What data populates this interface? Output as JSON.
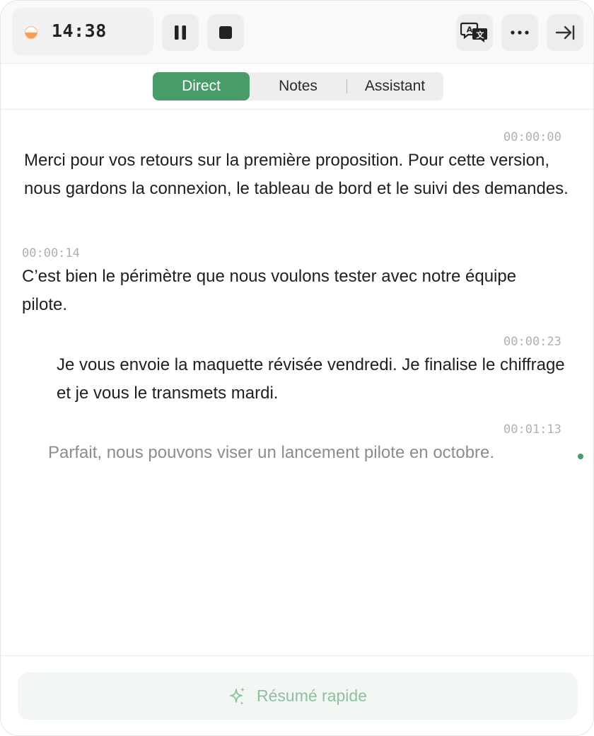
{
  "header": {
    "timer": "14:38",
    "buttons": {
      "pause": "pause-icon",
      "stop": "stop-icon",
      "translate": "translate-icon",
      "more": "more-icon",
      "collapse": "collapse-right-icon"
    }
  },
  "tabs": [
    {
      "label": "Direct",
      "active": true
    },
    {
      "label": "Notes",
      "active": false
    },
    {
      "label": "Assistant",
      "active": false
    }
  ],
  "transcript": [
    {
      "time": "00:00:00",
      "text": "Merci pour vos retours sur la première proposition. Pour cette version, nous gardons la connexion, le tableau de bord et le suivi des demandes."
    },
    {
      "time": "00:00:14",
      "text": "C’est bien le périmètre que nous voulons tester avec notre équipe pilote."
    },
    {
      "time": "00:00:23",
      "text": "Je vous envoie la maquette révisée vendredi. Je finalise le chiffrage et je vous le transmets mardi."
    },
    {
      "time": "00:01:13",
      "text": "Parfait, nous pouvons viser un lancement pilote en octobre."
    }
  ],
  "footer": {
    "summary_label": "Résumé rapide",
    "summary_icon": "sparkle-icon"
  },
  "colors": {
    "accent": "#4a9b6a",
    "recording": "#f59f5a",
    "summary_text": "#8fbf9e"
  }
}
